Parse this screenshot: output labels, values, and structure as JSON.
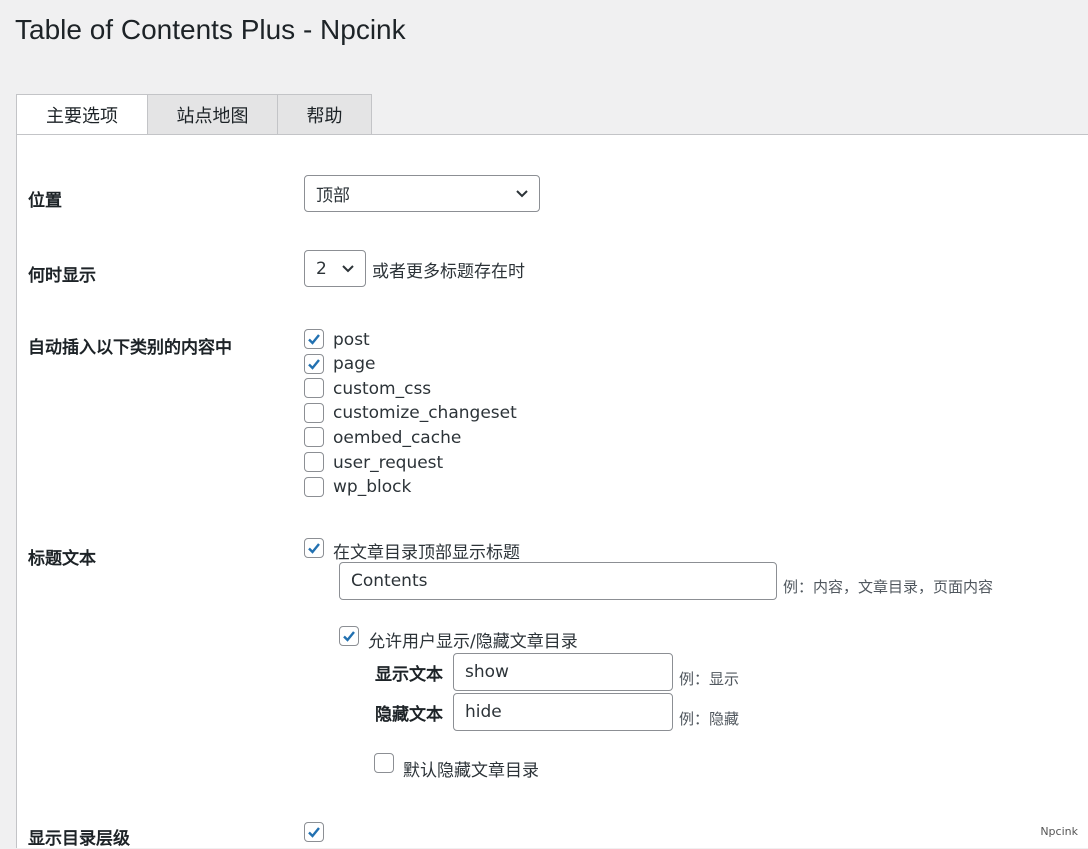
{
  "page": {
    "title": "Table of Contents Plus - Npcink"
  },
  "tabs": [
    {
      "label": "主要选项",
      "active": true
    },
    {
      "label": "站点地图",
      "active": false
    },
    {
      "label": "帮助",
      "active": false
    }
  ],
  "position": {
    "label": "位置",
    "value": "顶部"
  },
  "show_when": {
    "label": "何时显示",
    "value": "2",
    "suffix": "或者更多标题存在时"
  },
  "auto_insert": {
    "label": "自动插入以下类别的内容中",
    "items": [
      {
        "label": "post",
        "checked": true
      },
      {
        "label": "page",
        "checked": true
      },
      {
        "label": "custom_css",
        "checked": false
      },
      {
        "label": "customize_changeset",
        "checked": false
      },
      {
        "label": "oembed_cache",
        "checked": false
      },
      {
        "label": "user_request",
        "checked": false
      },
      {
        "label": "wp_block",
        "checked": false
      }
    ]
  },
  "heading_text": {
    "label": "标题文本",
    "show_heading_label": "在文章目录顶部显示标题",
    "show_heading_checked": true,
    "heading_value": "Contents",
    "heading_hint": "例：内容，文章目录，页面内容",
    "allow_toggle_label": "允许用户显示/隐藏文章目录",
    "allow_toggle_checked": true,
    "show_text_label": "显示文本",
    "show_text_value": "show",
    "show_text_hint": "例：显示",
    "hide_text_label": "隐藏文本",
    "hide_text_value": "hide",
    "hide_text_hint": "例：隐藏",
    "default_hidden_label": "默认隐藏文章目录",
    "default_hidden_checked": false
  },
  "hierarchy": {
    "label": "显示目录层级",
    "checked": true
  },
  "watermark": "Npcink",
  "colors": {
    "accent": "#2271b1",
    "border": "#8c8f94",
    "background": "#f0f0f1"
  }
}
